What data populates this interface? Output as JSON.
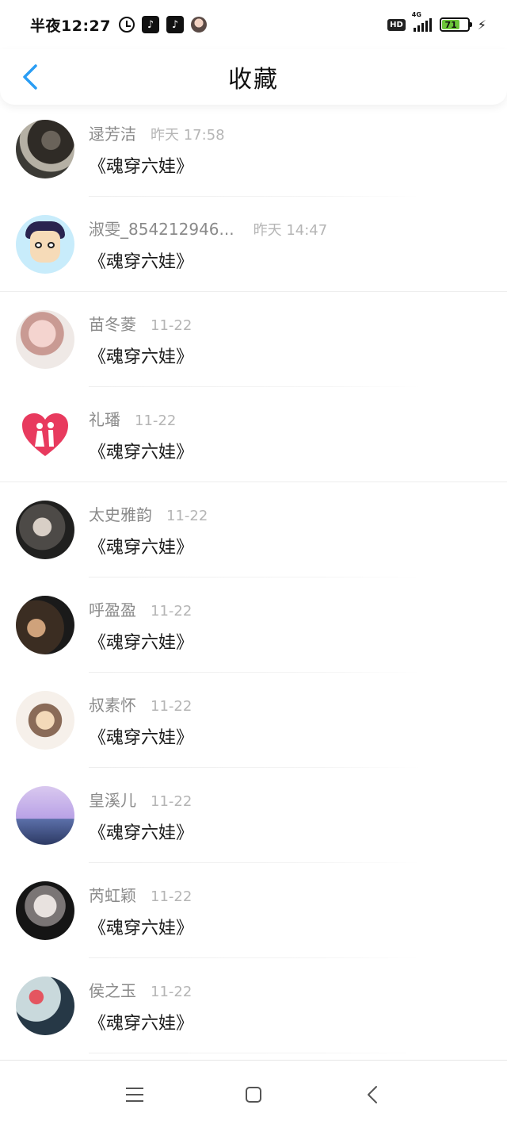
{
  "status_bar": {
    "time": "半夜12:27",
    "hd_label": "HD",
    "network_label": "4G",
    "battery_level": "71",
    "battery_fraction": 0.71
  },
  "header": {
    "title": "收藏",
    "back_icon": "chevron-left-icon",
    "accent_color": "#2a9df4"
  },
  "favorites": [
    {
      "name": "逯芳洁",
      "time": "昨天 17:58",
      "book": "《魂穿六娃》"
    },
    {
      "name": "淑雯_854212946...",
      "time": "昨天 14:47",
      "book": "《魂穿六娃》"
    },
    {
      "name": "苗冬菱",
      "time": "11-22",
      "book": "《魂穿六娃》"
    },
    {
      "name": "礼璠",
      "time": "11-22",
      "book": "《魂穿六娃》"
    },
    {
      "name": "太史雅韵",
      "time": "11-22",
      "book": "《魂穿六娃》"
    },
    {
      "name": "呼盈盈",
      "time": "11-22",
      "book": "《魂穿六娃》"
    },
    {
      "name": "叔素怀",
      "time": "11-22",
      "book": "《魂穿六娃》"
    },
    {
      "name": "皇溪儿",
      "time": "11-22",
      "book": "《魂穿六娃》"
    },
    {
      "name": "芮虹颖",
      "time": "11-22",
      "book": "《魂穿六娃》"
    },
    {
      "name": "侯之玉",
      "time": "11-22",
      "book": "《魂穿六娃》"
    }
  ],
  "nav_bar": {
    "icons": [
      "menu-icon",
      "home-icon",
      "back-icon"
    ]
  }
}
